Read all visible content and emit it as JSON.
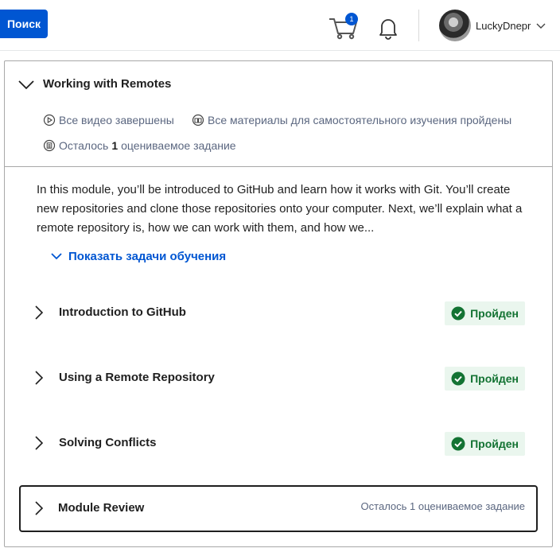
{
  "header": {
    "search_label": "Поиск",
    "cart_count": "1",
    "username": "LuckyDnepr"
  },
  "module": {
    "title": "Working with Remotes",
    "meta": {
      "videos": "Все видео завершены",
      "materials": "Все материалы для самостоятельного изучения пройдены",
      "remaining_prefix": "Осталось",
      "remaining_count": "1",
      "remaining_suffix": "оцениваемое задание"
    },
    "description": "In this module, you’ll be introduced to GitHub and learn how it works with Git. You’ll create new repositories and clone those repositories onto your computer. Next, we’ll explain what a remote repository is, how we can work with them, and how we...",
    "learning_link": "Показать задачи обучения",
    "lessons": [
      {
        "title": "Introduction to GitHub",
        "status": "Пройден"
      },
      {
        "title": "Using a Remote Repository",
        "status": "Пройден"
      },
      {
        "title": "Solving Conflicts",
        "status": "Пройден"
      },
      {
        "title": "Module Review",
        "remaining": "Осталось 1 оцениваемое задание"
      }
    ]
  },
  "colors": {
    "accent": "#0056d2",
    "success": "#137333",
    "success_bg": "#eaf6ee"
  }
}
